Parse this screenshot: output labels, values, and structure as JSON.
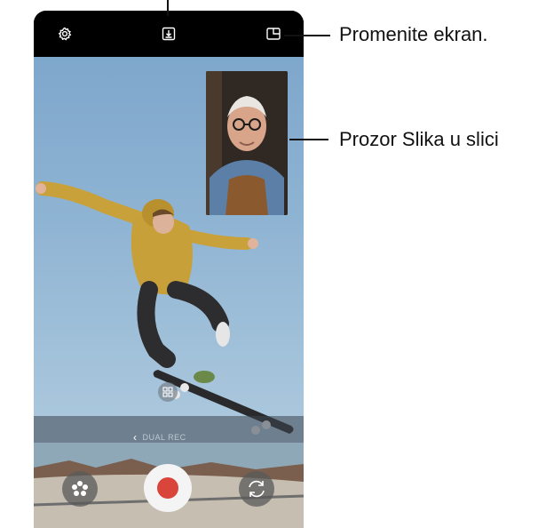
{
  "callouts": {
    "change_screen": "Promenite ekran.",
    "pip_window": "Prozor Slika u slici"
  },
  "toolbar": {
    "settings_icon": "gear-icon",
    "save_icon": "download-icon",
    "layout_icon": "split-screen-icon"
  },
  "mode_selector": {
    "label": "DUAL REC",
    "back_icon": "chevron-left-icon"
  },
  "controls": {
    "effects_icon": "sparkle-icon",
    "record_icon": "record-icon",
    "switch_icon": "camera-switch-icon"
  },
  "colors": {
    "record_red": "#d9443b",
    "topbar": "#000000",
    "sky": "#8fb4d3"
  }
}
